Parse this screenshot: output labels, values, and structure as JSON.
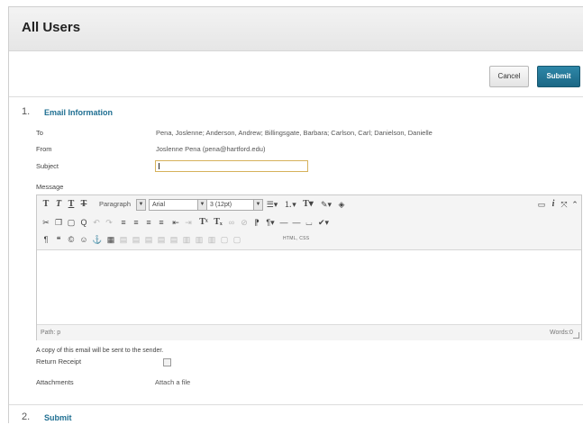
{
  "page": {
    "title": "All Users"
  },
  "actions": {
    "cancel_label": "Cancel",
    "submit_label": "Submit"
  },
  "step1": {
    "number": "1.",
    "title": "Email Information",
    "to_label": "To",
    "to_value": "Pena, Joslenne; Anderson, Andrew; Billingsgate, Barbara; Carlson, Carl; Danielson, Danielle",
    "from_label": "From",
    "from_value": "Joslenne Pena (pena@hartford.edu)",
    "subject_label": "Subject",
    "subject_value": "",
    "message_label": "Message"
  },
  "editor": {
    "paragraph_label": "Paragraph",
    "font_value": "Arial",
    "size_value": "3 (12pt)",
    "html_css_label": "HTML, CSS",
    "path_text": "Path: p",
    "words_text": "Words:0"
  },
  "step1_footer": {
    "copy_note": "A copy of this email will be sent to the sender.",
    "return_receipt_label": "Return Receipt",
    "return_receipt_checked": false,
    "attachments_label": "Attachments",
    "attach_link": "Attach a file"
  },
  "step2": {
    "number": "2.",
    "title": "Submit"
  }
}
